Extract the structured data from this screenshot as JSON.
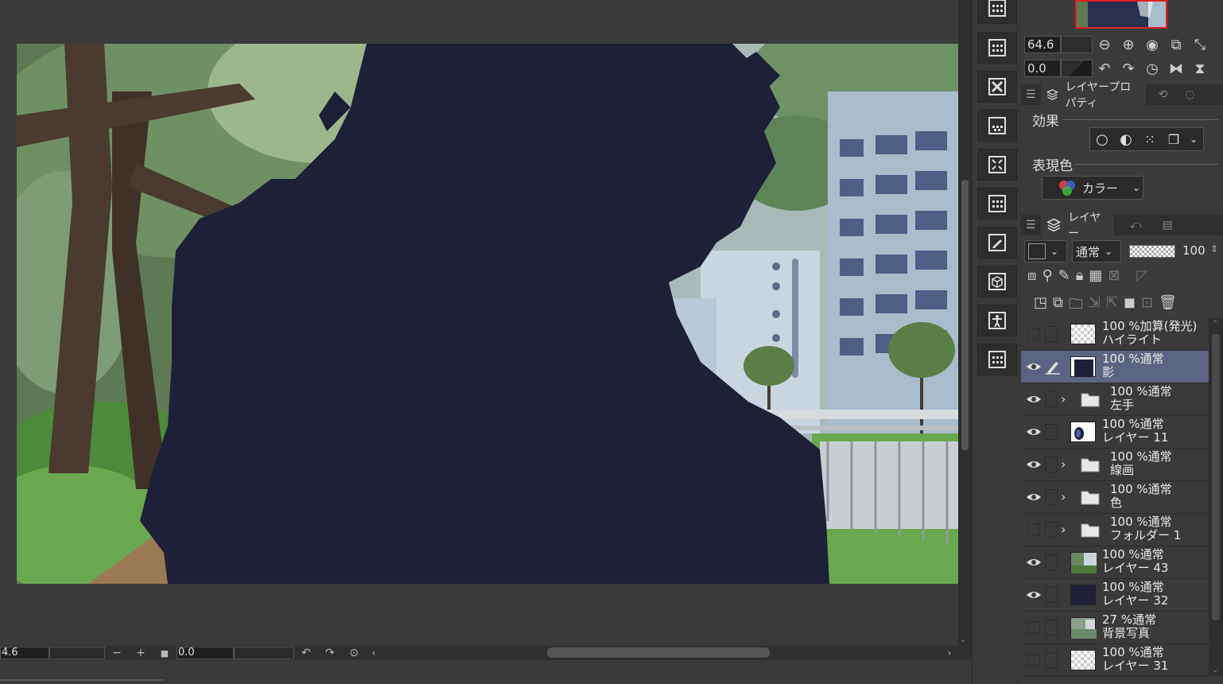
{
  "canvas_bottom_bar": {
    "zoom_value": "4.6",
    "rotate_value": "0.0",
    "zoom_out": "−",
    "zoom_in": "+",
    "fit": "■"
  },
  "navigator": {
    "zoom_value": "64.6",
    "rotate_value": "0.0"
  },
  "layer_property_panel": {
    "tab_label": "レイヤープロパティ",
    "effect_label": "効果",
    "expression_color_label": "表現色",
    "expression_color_value": "カラー"
  },
  "layer_panel": {
    "tab_label": "レイヤー",
    "blend_mode": "通常",
    "opacity": "100",
    "layers": [
      {
        "opacity_mode": "100 %加算(発光)",
        "name": "ハイライト",
        "visible": false,
        "type": "layer",
        "selected": false
      },
      {
        "opacity_mode": "100 %通常",
        "name": "影",
        "visible": true,
        "type": "layer",
        "selected": true
      },
      {
        "opacity_mode": "100 %通常",
        "name": "左手",
        "visible": true,
        "type": "folder",
        "selected": false
      },
      {
        "opacity_mode": "100 %通常",
        "name": "レイヤー 11",
        "visible": true,
        "type": "layer",
        "selected": false
      },
      {
        "opacity_mode": "100 %通常",
        "name": "線画",
        "visible": true,
        "type": "folder",
        "selected": false
      },
      {
        "opacity_mode": "100 %通常",
        "name": "色",
        "visible": true,
        "type": "folder",
        "selected": false
      },
      {
        "opacity_mode": "100 %通常",
        "name": "フォルダー 1",
        "visible": false,
        "type": "folder",
        "selected": false
      },
      {
        "opacity_mode": "100 %通常",
        "name": "レイヤー 43",
        "visible": true,
        "type": "layer",
        "selected": false
      },
      {
        "opacity_mode": "100 %通常",
        "name": "レイヤー 32",
        "visible": true,
        "type": "layer",
        "selected": false
      },
      {
        "opacity_mode": "27 %通常",
        "name": "背景写真",
        "visible": false,
        "type": "layer",
        "selected": false
      },
      {
        "opacity_mode": "100 %通常",
        "name": "レイヤー 31",
        "visible": false,
        "type": "layer",
        "selected": false
      }
    ]
  },
  "colors": {
    "silhouette": "#1e2038",
    "selected_layer": "#5b6583",
    "navigator_frame": "#e02020"
  }
}
